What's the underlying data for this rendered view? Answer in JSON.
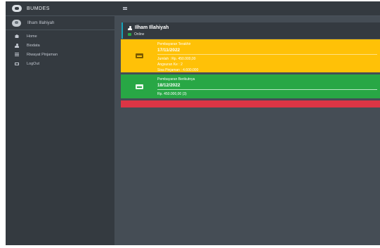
{
  "brand": {
    "name": "BUMDES"
  },
  "sidebar": {
    "user_name": "Ilham Illahiyah",
    "items": [
      {
        "label": "Home",
        "icon": "home-icon"
      },
      {
        "label": "Biodata",
        "icon": "user-icon"
      },
      {
        "label": "Riwayat Pinjaman",
        "icon": "list-icon"
      },
      {
        "label": "LogOut",
        "icon": "logout-icon"
      }
    ]
  },
  "header": {
    "menu_icon": "hamburger-icon"
  },
  "user_card": {
    "name": "Ilham Illahiyah",
    "status": "Online"
  },
  "last_payment": {
    "title": "Pembayaran Terakhir",
    "date": "17/11/2022",
    "amount": "Jumlah : Rp. 450.000,00",
    "installment": "Angsuran Ke : 2",
    "remaining": "Sisa Pinjaman : 4.600.000"
  },
  "next_payment": {
    "title": "Pembayaran Berikutnya",
    "date": "18/12/2022",
    "amount": "Rp. 450.000,00 (3)"
  },
  "colors": {
    "sidebar": "#343a40",
    "content": "#454d55",
    "warning": "#ffc107",
    "success": "#28a745",
    "danger": "#dc3545",
    "info": "#17a2b8"
  }
}
